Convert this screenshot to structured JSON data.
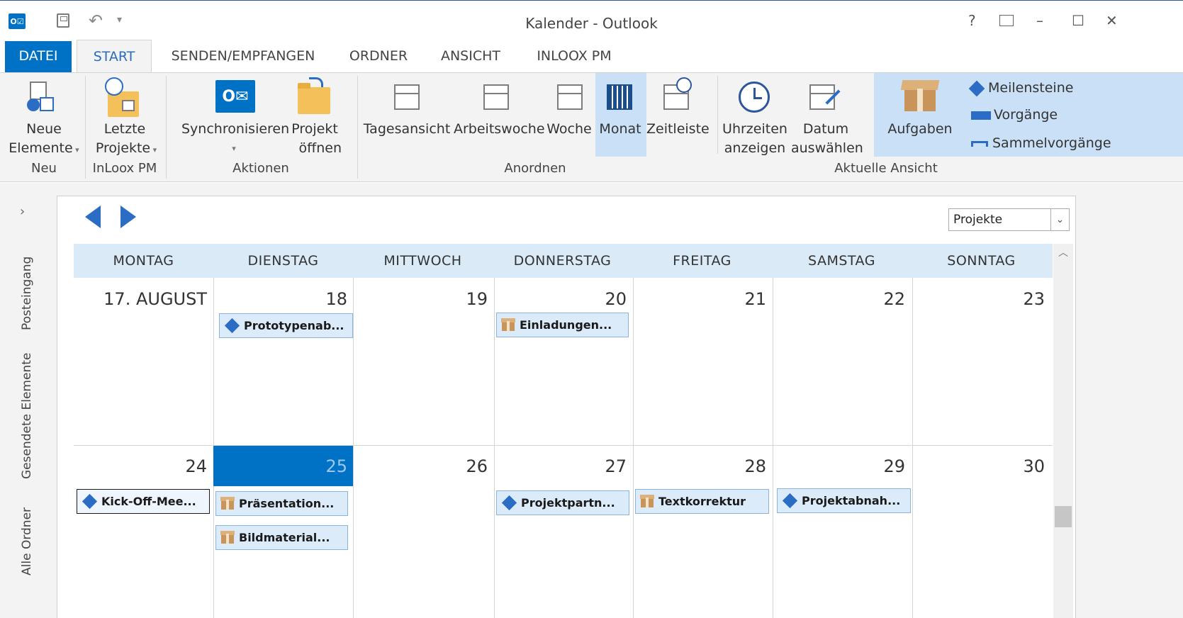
{
  "window": {
    "title": "Kalender - Outlook"
  },
  "quick_access": {
    "app_icon": "outlook-icon",
    "save_icon": "save-icon",
    "undo_icon": "undo-icon",
    "more": "▾"
  },
  "window_controls": {
    "help": "?",
    "ribbon_display": "ribbon-display-icon",
    "minimize": "–",
    "maximize": "☐",
    "close": "✕"
  },
  "tabs": [
    {
      "label": "DATEI"
    },
    {
      "label": "START"
    },
    {
      "label": "SENDEN/EMPFANGEN"
    },
    {
      "label": "ORDNER"
    },
    {
      "label": "ANSICHT"
    },
    {
      "label": "INLOOX PM"
    }
  ],
  "ribbon": {
    "neu": {
      "btn1": "Neue",
      "btn2": "Elemente",
      "label": "Neu"
    },
    "inloox": {
      "btn1": "Letzte",
      "btn2": "Projekte",
      "label": "InLoox PM"
    },
    "aktionen": {
      "sync": "Synchronisieren",
      "projekt1": "Projekt",
      "projekt2": "öffnen",
      "label": "Aktionen"
    },
    "anordnen": {
      "tagesansicht": "Tagesansicht",
      "arbeitswoche": "Arbeitswoche",
      "woche": "Woche",
      "monat": "Monat",
      "zeitleiste": "Zeitleiste",
      "uhrzeiten1": "Uhrzeiten",
      "uhrzeiten2": "anzeigen",
      "datum1": "Datum",
      "datum2": "auswählen",
      "label": "Anordnen"
    },
    "ansicht": {
      "aufgaben": "Aufgaben",
      "meilensteine": "Meilensteine",
      "vorgaenge": "Vorgänge",
      "sammelvorgaenge": "Sammelvorgänge",
      "label": "Aktuelle Ansicht"
    }
  },
  "rail": {
    "expand": "›",
    "items": [
      "Posteingang",
      "Gesendete Elemente",
      "Alle Ordner"
    ]
  },
  "calendar": {
    "filter_value": "Projekte",
    "days": [
      "MONTAG",
      "DIENSTAG",
      "MITTWOCH",
      "DONNERSTAG",
      "FREITAG",
      "SAMSTAG",
      "SONNTAG"
    ],
    "week1": [
      "17. AUGUST",
      "18",
      "19",
      "20",
      "21",
      "22",
      "23"
    ],
    "week2": [
      "24",
      "25",
      "26",
      "27",
      "28",
      "29",
      "30"
    ],
    "today": "25",
    "appointments": [
      {
        "label": "Prototypenab...",
        "kind": "milestone"
      },
      {
        "label": "Einladungen...",
        "kind": "task"
      },
      {
        "label": "Kick-Off-Mee...",
        "kind": "milestone"
      },
      {
        "label": "Präsentation...",
        "kind": "task"
      },
      {
        "label": "Bildmaterial...",
        "kind": "task"
      },
      {
        "label": "Projektpartn...",
        "kind": "milestone"
      },
      {
        "label": "Textkorrektur",
        "kind": "task"
      },
      {
        "label": "Projektabnah...",
        "kind": "milestone"
      }
    ]
  },
  "colors": {
    "accent": "#0072c6",
    "header_bg": "#daeaf7",
    "milestone": "#2b6cc4",
    "task_box": "#c9945a"
  }
}
